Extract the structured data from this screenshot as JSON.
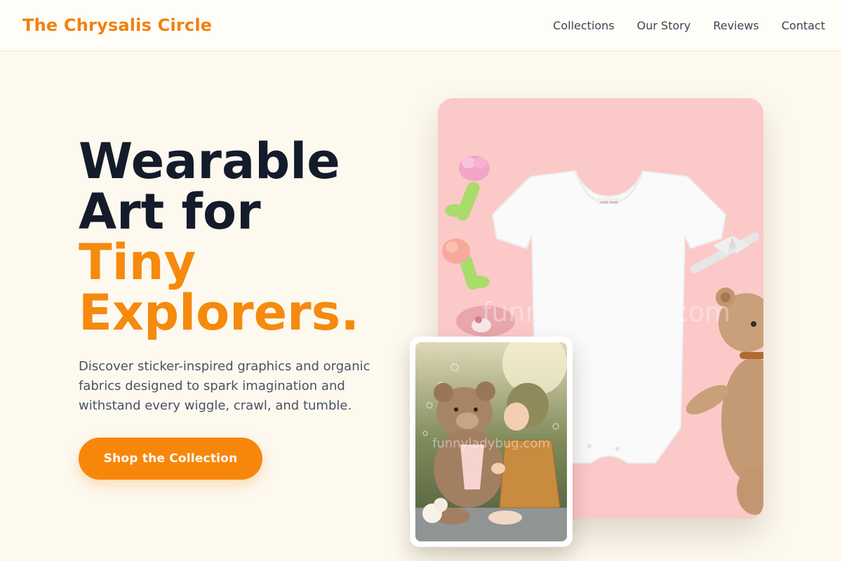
{
  "brand": {
    "name": "The Chrysalis Circle",
    "accent_color": "#f0820f"
  },
  "nav": {
    "items": [
      {
        "label": "Collections"
      },
      {
        "label": "Our Story"
      },
      {
        "label": "Reviews"
      },
      {
        "label": "Contact"
      }
    ]
  },
  "hero": {
    "title_line1": "Wearable",
    "title_line2": "Art for",
    "title_accent1": "Tiny",
    "title_accent2": "Explorers.",
    "description": "Discover sticker-inspired graphics and organic fabrics designed to spark imagination and withstand every wiggle, crawl, and tumble.",
    "cta_label": "Shop the Collection"
  },
  "images": {
    "main_watermark": "funnyladybug.com",
    "inset_watermark": "funnyladybug.com",
    "onesie_tag": "cutie lover"
  },
  "colors": {
    "background": "#fdf9ef",
    "heading": "#141b2a",
    "accent": "#f58a0e",
    "body_text": "#4a5262",
    "image_pink": "#fbc8c8"
  }
}
